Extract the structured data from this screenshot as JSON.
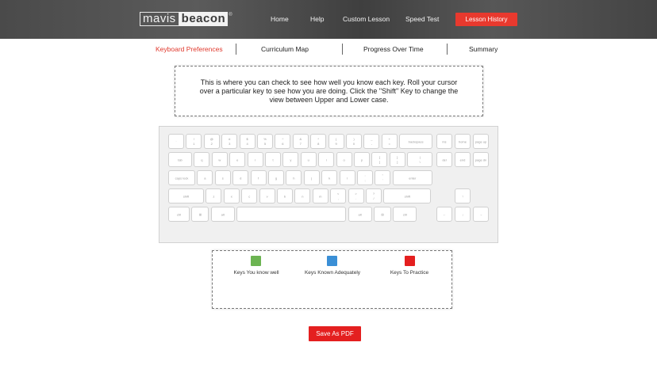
{
  "brand": {
    "part1": "mavis",
    "part2": "beacon",
    "reg": "®"
  },
  "nav": {
    "home": "Home",
    "help": "Help",
    "custom_lesson": "Custom Lesson",
    "speed_test": "Speed Test",
    "lesson_history": "Lesson History"
  },
  "tabs": {
    "keyboard_preferences": "Keyboard Preferences",
    "curriculum_map": "Curriculum Map",
    "progress_over_time": "Progress Over Time",
    "summary": "Summary"
  },
  "info_text": "This is where you can check to see how well you know each key. Roll your cursor over a particular key to see how you are doing. Click the \"Shift\" Key to change the view between Upper and Lower case.",
  "keyboard": {
    "row1": [
      {
        "t": "",
        "b": "`"
      },
      {
        "t": "!",
        "b": "1"
      },
      {
        "t": "@",
        "b": "2"
      },
      {
        "t": "#",
        "b": "3"
      },
      {
        "t": "$",
        "b": "4"
      },
      {
        "t": "%",
        "b": "5"
      },
      {
        "t": "^",
        "b": "6"
      },
      {
        "t": "&",
        "b": "7"
      },
      {
        "t": "*",
        "b": "8"
      },
      {
        "t": "(",
        "b": "9"
      },
      {
        "t": ")",
        "b": "0"
      },
      {
        "t": "_",
        "b": "-"
      },
      {
        "t": "+",
        "b": "="
      },
      {
        "t": "",
        "b": "backspace"
      }
    ],
    "row2": [
      {
        "t": "",
        "b": "tab"
      },
      {
        "t": "",
        "b": "q"
      },
      {
        "t": "",
        "b": "w"
      },
      {
        "t": "",
        "b": "e"
      },
      {
        "t": "",
        "b": "r"
      },
      {
        "t": "",
        "b": "t"
      },
      {
        "t": "",
        "b": "y"
      },
      {
        "t": "",
        "b": "u"
      },
      {
        "t": "",
        "b": "i"
      },
      {
        "t": "",
        "b": "o"
      },
      {
        "t": "",
        "b": "p"
      },
      {
        "t": "{",
        "b": "["
      },
      {
        "t": "}",
        "b": "]"
      },
      {
        "t": "|",
        "b": "\\"
      }
    ],
    "row3": [
      {
        "t": "",
        "b": "caps lock"
      },
      {
        "t": "",
        "b": "a"
      },
      {
        "t": "",
        "b": "s"
      },
      {
        "t": "",
        "b": "d"
      },
      {
        "t": "",
        "b": "f"
      },
      {
        "t": "",
        "b": "g"
      },
      {
        "t": "",
        "b": "h"
      },
      {
        "t": "",
        "b": "j"
      },
      {
        "t": "",
        "b": "k"
      },
      {
        "t": "",
        "b": "l"
      },
      {
        "t": ":",
        "b": ";"
      },
      {
        "t": "\"",
        "b": "'"
      },
      {
        "t": "",
        "b": "enter"
      }
    ],
    "row4": [
      {
        "t": "",
        "b": "shift"
      },
      {
        "t": "",
        "b": "z"
      },
      {
        "t": "",
        "b": "x"
      },
      {
        "t": "",
        "b": "c"
      },
      {
        "t": "",
        "b": "v"
      },
      {
        "t": "",
        "b": "b"
      },
      {
        "t": "",
        "b": "n"
      },
      {
        "t": "",
        "b": "m"
      },
      {
        "t": "<",
        "b": ","
      },
      {
        "t": ">",
        "b": "."
      },
      {
        "t": "?",
        "b": "/"
      },
      {
        "t": "",
        "b": "shift"
      }
    ],
    "row5": [
      {
        "t": "",
        "b": "ctrl"
      },
      {
        "t": "",
        "b": "⊞"
      },
      {
        "t": "",
        "b": "alt"
      },
      {
        "t": "",
        "b": ""
      },
      {
        "t": "",
        "b": "alt"
      },
      {
        "t": "",
        "b": "⊞"
      },
      {
        "t": "",
        "b": "ctrl"
      }
    ],
    "nav_cluster": [
      {
        "t": "",
        "b": "ins"
      },
      {
        "t": "",
        "b": "home"
      },
      {
        "t": "",
        "b": "page up"
      },
      {
        "t": "",
        "b": "del"
      },
      {
        "t": "",
        "b": "end"
      },
      {
        "t": "",
        "b": "page dn"
      }
    ],
    "arrows": {
      "up": "↑",
      "left": "←",
      "down": "↓",
      "right": "→"
    }
  },
  "legend": {
    "well": {
      "label": "Keys You know well",
      "color": "#6cb452"
    },
    "adequate": {
      "label": "Keys Known Adequately",
      "color": "#3a8fd6"
    },
    "practice": {
      "label": "Keys To Practice",
      "color": "#e41f1f"
    }
  },
  "save_pdf": "Save As PDF",
  "colors": {
    "accent": "#e8392e",
    "active_tab": "#e0392d",
    "topbar": "#4d4d4d"
  }
}
